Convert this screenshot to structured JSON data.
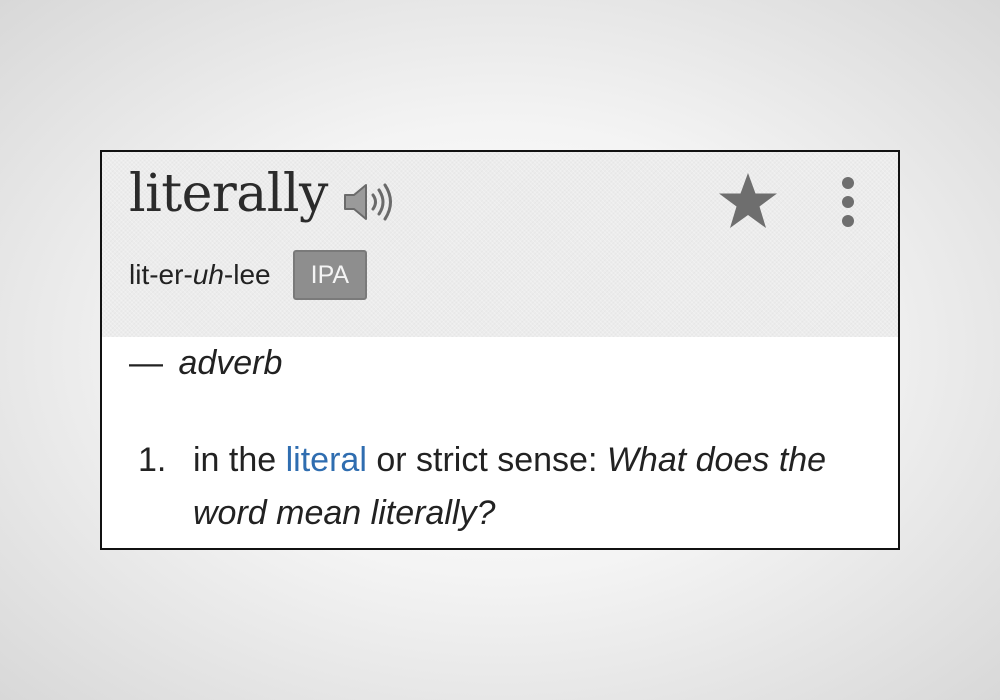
{
  "entry": {
    "word": "literally",
    "pronunciation_parts": [
      "lit-er-",
      "uh",
      "-lee"
    ],
    "ipa_button_label": "IPA",
    "part_of_speech_dash": "—",
    "part_of_speech": "adverb",
    "icons": {
      "audio": "speaker-icon",
      "favorite": "star-icon",
      "more": "more-vertical-icon"
    }
  },
  "definitions": [
    {
      "number": "1.",
      "before_link": "in the ",
      "link_text": "literal",
      "after_link": " or strict sense: ",
      "example": "What does the word mean literally?"
    }
  ],
  "colors": {
    "link": "#2f6db0",
    "header_bg": "#ececec",
    "ipa_bg": "#8e8e8e",
    "icon": "#6a6a6a"
  }
}
